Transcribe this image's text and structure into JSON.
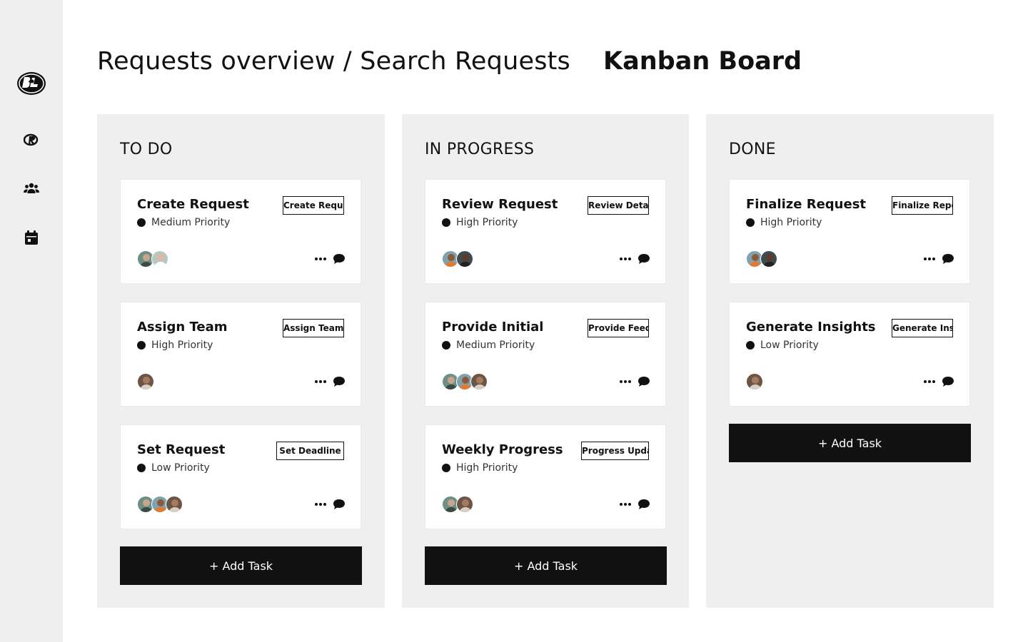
{
  "header": {
    "breadcrumb": "Requests overview / Search Requests",
    "title": "Kanban Board"
  },
  "sidebar": {
    "items": [
      {
        "icon": "logo-icon"
      },
      {
        "icon": "requests-icon"
      },
      {
        "icon": "team-icon"
      },
      {
        "icon": "calendar-icon"
      }
    ]
  },
  "colors": {
    "sidebar_bg": "#efefef",
    "column_bg": "#efefef",
    "button_bg": "#111111",
    "button_text": "#ffffff"
  },
  "columns": [
    {
      "title": "TO DO",
      "add_label": "+ Add Task",
      "cards": [
        {
          "title": "Create Request",
          "tag": "Create Request",
          "priority": "Medium Priority",
          "avatars": 2
        },
        {
          "title": "Assign Team",
          "tag": "Assign Team",
          "priority": "High Priority",
          "avatars": 1
        },
        {
          "title": "Set Request",
          "tag": "Set Deadline",
          "priority": "Low Priority",
          "avatars": 3
        }
      ]
    },
    {
      "title": "IN PROGRESS",
      "add_label": "+ Add Task",
      "cards": [
        {
          "title": "Review Request",
          "tag": "Review Details",
          "priority": "High Priority",
          "avatars": 2
        },
        {
          "title": "Provide Initial",
          "tag": "Provide Feedback",
          "priority": "Medium Priority",
          "avatars": 3
        },
        {
          "title": "Weekly Progress",
          "tag": "Progress Update",
          "priority": "High Priority",
          "avatars": 2
        }
      ]
    },
    {
      "title": "DONE",
      "add_label": "+ Add Task",
      "cards": [
        {
          "title": "Finalize Request",
          "tag": "Finalize Report",
          "priority": "High Priority",
          "avatars": 2
        },
        {
          "title": "Generate Insights",
          "tag": "Generate Insights",
          "priority": "Low Priority",
          "avatars": 1
        }
      ]
    }
  ]
}
